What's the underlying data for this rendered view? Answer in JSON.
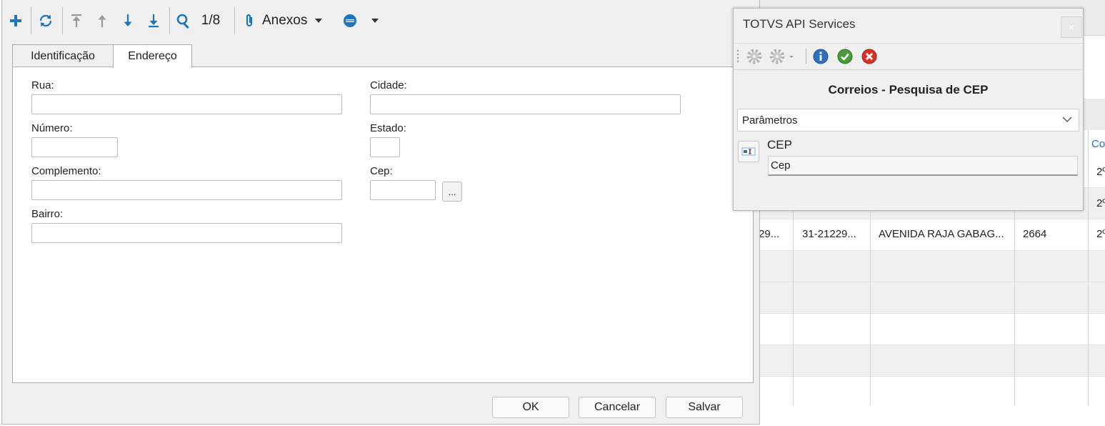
{
  "toolbar": {
    "record_counter": "1/8",
    "attachments_label": "Anexos"
  },
  "tabs": [
    {
      "label": "Identificação",
      "active": false
    },
    {
      "label": "Endereço",
      "active": true
    }
  ],
  "form": {
    "rua_label": "Rua:",
    "numero_label": "Número:",
    "complemento_label": "Complemento:",
    "bairro_label": "Bairro:",
    "cidade_label": "Cidade:",
    "estado_label": "Estado:",
    "cep_label": "Cep:",
    "cep_lookup_label": "...",
    "rua_value": "",
    "numero_value": "",
    "complemento_value": "",
    "bairro_value": "",
    "cidade_value": "",
    "estado_value": "",
    "cep_value": ""
  },
  "buttons": {
    "ok": "OK",
    "cancel": "Cancelar",
    "save": "Salvar"
  },
  "dialog": {
    "title": "TOTVS API Services",
    "close_glyph": "×",
    "heading": "Correios - Pesquisa de CEP",
    "section_label": "Parâmetros",
    "param_label": "CEP",
    "param_value": "Cep"
  },
  "background_grid": {
    "column_header_partial": "Co",
    "rows": [
      {
        "c5": "2º"
      },
      {
        "c5": "2º"
      },
      {
        "c1": "29...",
        "c2": "31-21229...",
        "c3": "AVENIDA RAJA GABAG...",
        "c4": "2664",
        "c5": "2º"
      }
    ]
  },
  "colors": {
    "accent_blue": "#1f75bb",
    "link_blue": "#1f6fbf",
    "window_bg": "#f0f0f0"
  },
  "icons": {
    "add": "plus-icon",
    "refresh": "refresh-icon",
    "first": "arrow-first-icon",
    "prev": "arrow-up-icon",
    "next": "arrow-down-icon",
    "last": "arrow-last-icon",
    "search": "search-icon",
    "attachments": "paperclip-icon",
    "more": "record-options-icon"
  }
}
